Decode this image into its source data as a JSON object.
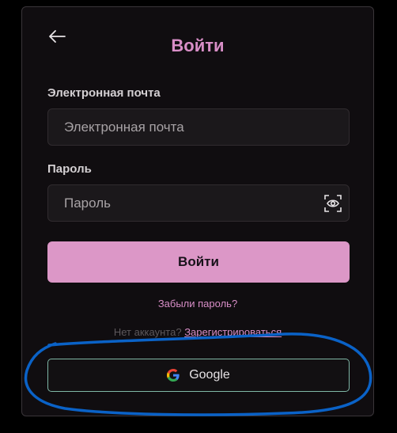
{
  "login": {
    "title": "Войти",
    "email_label": "Электронная почта",
    "email_placeholder": "Электронная почта",
    "email_value": "",
    "password_label": "Пароль",
    "password_placeholder": "Пароль",
    "password_value": "",
    "submit_label": "Войти",
    "forgot_label": "Забыли пароль?",
    "no_account_text": "Нет аккаунта?",
    "register_label": "Зарегистрироваться",
    "google_label": "Google"
  },
  "icons": {
    "back": "arrow-left-icon",
    "eye": "eye-icon",
    "google": "google-g-icon"
  },
  "colors": {
    "accent": "#dc97c7",
    "title": "#d88ec7",
    "card_background": "#100d10",
    "google_border": "#7fb7a6",
    "annotation_stroke": "#0a62c7"
  }
}
